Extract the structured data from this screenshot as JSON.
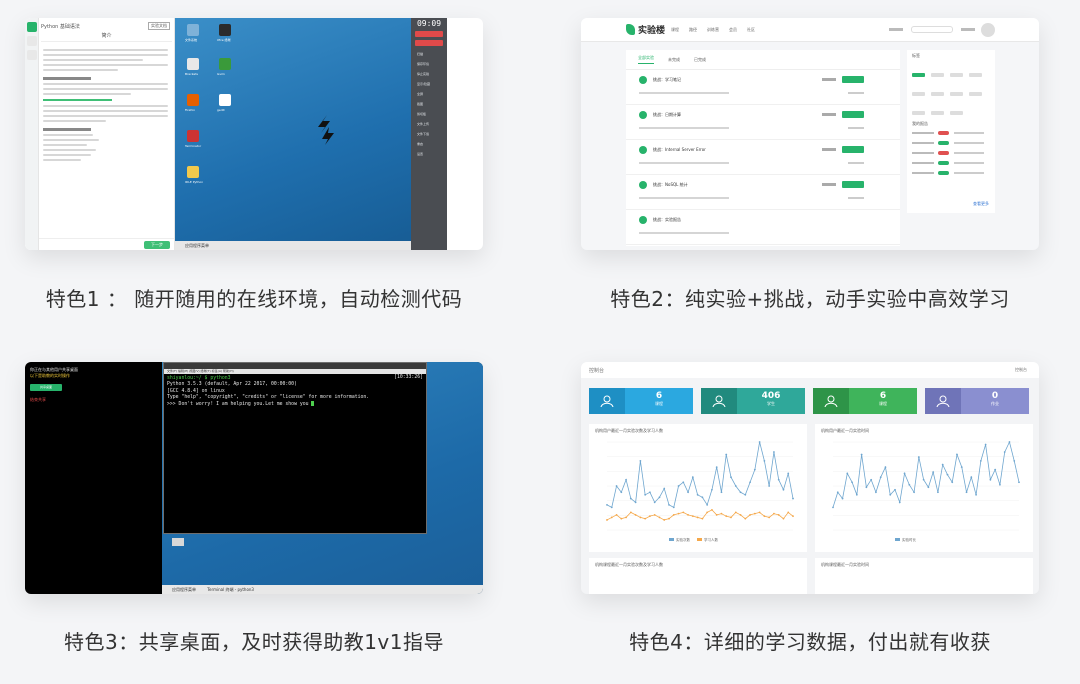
{
  "captions": {
    "c1": "特色1 ： 随开随用的在线环境，自动检测代码",
    "c2": "特色2：纯实验+挑战，动手实验中高效学习",
    "c3": "特色3：共享桌面，及时获得助教1v1指导",
    "c4": "特色4：详细的学习数据，付出就有收获"
  },
  "panel1": {
    "doc_title": "Python 基础语法",
    "doc_btn": "实验文档",
    "section": "简介",
    "desktop_time": "09:09",
    "taskbar": "应用程序菜单",
    "next_btn": "下一步",
    "desktop_icons": [
      {
        "label": "文件系统",
        "color": "#7fb2d8"
      },
      {
        "label": "Xfce 终端",
        "color": "#2b2b2b"
      },
      {
        "label": "Brackets",
        "color": "#e8e8e8"
      },
      {
        "label": "Gvim",
        "color": "#3a9a3a"
      },
      {
        "label": "Firefox",
        "color": "#e66000"
      },
      {
        "label": "Terminator",
        "color": "#cc3333"
      },
      {
        "label": "IDLE Python",
        "color": "#f2c94c"
      },
      {
        "label": "gedit",
        "color": "#ffffff"
      }
    ],
    "side_items": [
      "扫描",
      "保存环境",
      "停止实验",
      "显示/隐藏",
      "全屏",
      "截图",
      "剪切板",
      "文件上传",
      "文件下载",
      "重启",
      "设置"
    ]
  },
  "panel2": {
    "brand": "实验楼",
    "nav": [
      "课程",
      "路径",
      "训练营",
      "会员",
      "社区"
    ],
    "search_placeholder": "搜索",
    "tabs": [
      "全部实验",
      "未完成",
      "已完成"
    ],
    "items": [
      "挑战：学习笔记",
      "挑战：日期计算",
      "挑战：Internal Server Error",
      "挑战：NoSQL 统计",
      "挑战：实验报告"
    ],
    "card_titles": [
      "标签",
      "我的报告"
    ],
    "more": "查看更多"
  },
  "panel3": {
    "intro": "你正在与其他用户共享桌面",
    "intro2": "以下是助教的实时操作",
    "btn": "共享桌面",
    "red": "结束共享",
    "term_time": "[10:33:26]",
    "term_menu": "文件(F)  编辑(E)  视图(V)  终端(T)  标签(A)  帮助(H)",
    "term_lines": [
      "shiyanlou:~/ $ python3",
      "Python 3.5.3 (default, Apr 22 2017, 00:00:00)",
      "[GCC 4.8.4] on linux",
      "Type \"help\", \"copyright\", \"credits\" or \"license\" for more information.",
      ">>> Don't worry! I am helping you.Let me show you"
    ],
    "taskbar": "应用程序菜单",
    "taskbar2": "Terminal 终端 - python3"
  },
  "panel4": {
    "title": "控制台",
    "user": "控制台",
    "stats": [
      {
        "value": "6",
        "label": "课程",
        "color": "#2ba8e0",
        "dark": "#1e8fc4"
      },
      {
        "value": "406",
        "label": "学生",
        "color": "#2fa89a",
        "dark": "#218a7e"
      },
      {
        "value": "6",
        "label": "课程",
        "color": "#3fb45b",
        "dark": "#2e9448"
      },
      {
        "value": "0",
        "label": "作业",
        "color": "#8a8fd0",
        "dark": "#6f74b8"
      }
    ],
    "chart_titles": [
      "机构用户最近一月实验次数及学习人数",
      "机构用户最近一月实验时间",
      "机构课程最近一月实验次数及学习人数",
      "机构课程最近一月实验时间"
    ],
    "legend1": [
      "实验次数",
      "学习人数"
    ],
    "legend2": [
      "实验时长"
    ]
  },
  "colors": {
    "green": "#27b36b",
    "blue": "#1f6fae",
    "line_blue": "#6fa6cf",
    "line_orange": "#f5a84a"
  }
}
